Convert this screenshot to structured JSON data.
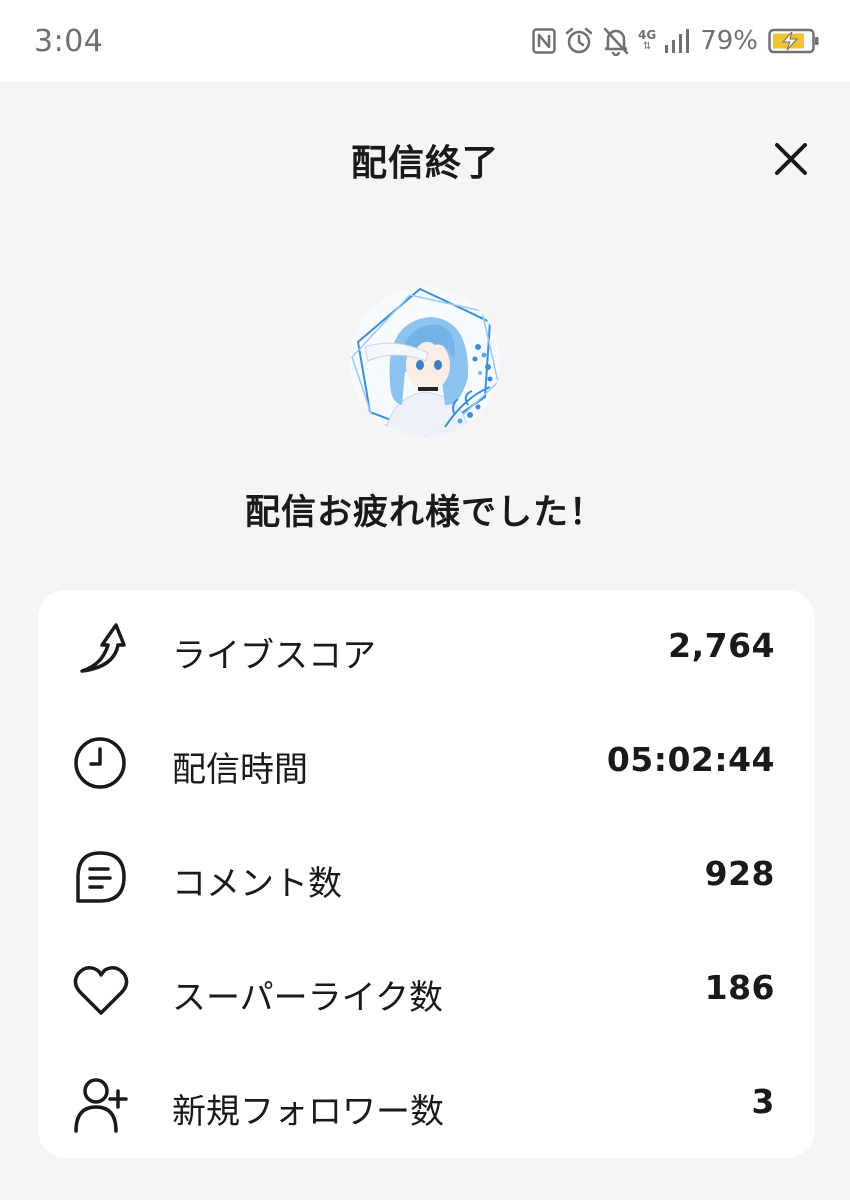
{
  "status_bar": {
    "time": "3:04",
    "network": "4G",
    "battery": "79%",
    "icons": [
      "nfc-icon",
      "alarm-icon",
      "bell-off-icon",
      "signal-icon",
      "battery-charging-icon"
    ]
  },
  "header": {
    "title": "配信終了",
    "close_icon": "close-icon"
  },
  "avatar": {
    "icon": "avatar-image",
    "colors": {
      "hair": "#8cc4ef",
      "accent": "#3a8fd8"
    }
  },
  "message": "配信お疲れ様でした！",
  "stats": [
    {
      "icon": "trending-up-arrow-icon",
      "label": "ライブスコア",
      "value": "2,764"
    },
    {
      "icon": "clock-icon",
      "label": "配信時間",
      "value": "05:02:44"
    },
    {
      "icon": "comment-icon",
      "label": "コメント数",
      "value": "928"
    },
    {
      "icon": "heart-icon",
      "label": "スーパーライク数",
      "value": "186"
    },
    {
      "icon": "add-user-icon",
      "label": "新規フォロワー数",
      "value": "3"
    }
  ]
}
